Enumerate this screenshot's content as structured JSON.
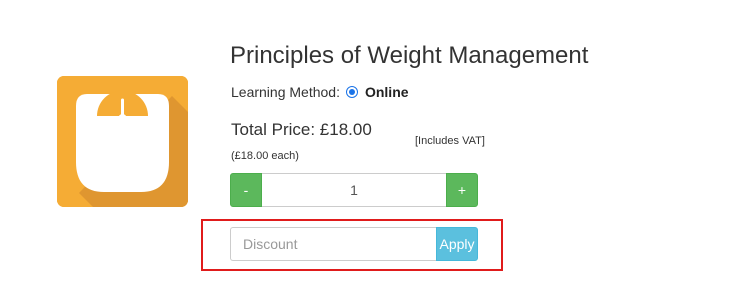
{
  "product": {
    "title": "Principles of Weight Management",
    "icon": "weighing-scale-icon"
  },
  "learning_method": {
    "label": "Learning Method:",
    "value": "Online",
    "selected": true
  },
  "pricing": {
    "total_label": "Total Price: £18.00",
    "each_label": "(£18.00 each)",
    "vat_note": "[Includes VAT]"
  },
  "quantity": {
    "minus_label": "-",
    "plus_label": "+",
    "value": "1"
  },
  "discount": {
    "placeholder": "Discount",
    "value": "",
    "apply_label": "Apply"
  },
  "colors": {
    "icon_background": "#f5ac35",
    "quantity_buttons": "#5cb85c",
    "apply_button": "#5bc0de",
    "highlight_border": "#e01b1b",
    "radio_accent": "#1a73e8"
  }
}
